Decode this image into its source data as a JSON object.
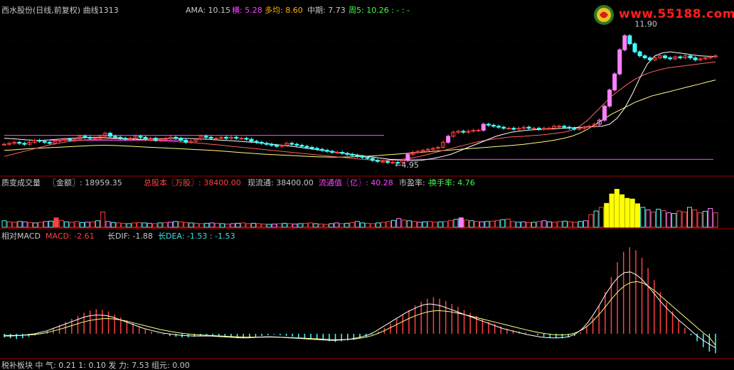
{
  "header": {
    "title": "西水股份(日线,前复权) 曲线1313",
    "ama_label": "AMA: 10.15",
    "heng_label": "横: 5.28",
    "duojun_label": "多均: 8.60",
    "zhongqi_label": "中期: 7.73",
    "zhou5_label": "周5: 10.26 : - : -"
  },
  "watermark": {
    "text": "www.55188.com",
    "icon": "logo-icon"
  },
  "volume_header": {
    "name": "质变成交量",
    "amount_label": "〖金额〗: 18959.35",
    "total_shares_label": "总股本〖万股〗: 38400.00",
    "float_label": "现流通: 38400.00",
    "float_value_label": "流通值〖亿〗: 40.28",
    "pe_label": "市盈率: -",
    "turnover_label": "换手率: 4.76"
  },
  "macd_header": {
    "name": "相对MACD",
    "macd_label": "MACD: -2.61",
    "dif_label": "长DIF: -1.88",
    "dea_label": "长DEA: -1.53 : -1.53"
  },
  "bottom_header": {
    "text": "税补板块 中 气: 0.21  1: 0.10  发 力: 7.53  组元: 0.00"
  },
  "chart_data": {
    "type": "candlestick",
    "price_annotations": {
      "high": "11.90",
      "low": "4.95"
    },
    "close": [
      5.9,
      5.95,
      6.0,
      5.95,
      5.9,
      6.0,
      6.1,
      6.05,
      6.0,
      5.95,
      6.05,
      6.1,
      6.15,
      6.1,
      6.15,
      6.3,
      6.25,
      6.2,
      6.2,
      6.3,
      6.45,
      6.3,
      6.25,
      6.2,
      6.15,
      6.2,
      6.3,
      6.25,
      6.15,
      6.2,
      6.1,
      6.15,
      6.2,
      6.25,
      6.2,
      6.1,
      6.0,
      6.05,
      6.15,
      6.3,
      6.25,
      6.2,
      6.2,
      6.25,
      6.2,
      6.25,
      6.2,
      6.2,
      6.15,
      6.05,
      6.0,
      5.95,
      5.9,
      5.85,
      5.8,
      5.85,
      5.95,
      5.9,
      5.85,
      5.8,
      5.75,
      5.7,
      5.65,
      5.6,
      5.55,
      5.5,
      5.5,
      5.45,
      5.4,
      5.35,
      5.3,
      5.25,
      5.2,
      5.1,
      5.05,
      5.05,
      5.0,
      5.0,
      4.98,
      5.1,
      5.4,
      5.5,
      5.55,
      5.6,
      5.65,
      5.7,
      5.75,
      6.0,
      6.3,
      6.5,
      6.55,
      6.5,
      6.55,
      6.6,
      6.6,
      6.9,
      6.85,
      6.8,
      6.75,
      6.7,
      6.7,
      6.65,
      6.7,
      6.75,
      6.7,
      6.7,
      6.65,
      6.7,
      6.7,
      6.8,
      6.8,
      6.75,
      6.7,
      6.65,
      6.7,
      6.75,
      6.8,
      6.9,
      7.1,
      7.8,
      8.6,
      9.4,
      10.6,
      11.3,
      10.9,
      10.5,
      10.3,
      10.2,
      10.1,
      10.2,
      10.3,
      10.2,
      10.15,
      10.25,
      10.2,
      10.3,
      10.2,
      10.1,
      10.15,
      10.2,
      10.25,
      10.3
    ],
    "ma_short": [
      6.2,
      6.18,
      6.15,
      6.12,
      6.1,
      6.1,
      6.12,
      6.15,
      6.18,
      6.2,
      6.22,
      6.24,
      6.25,
      6.24,
      6.22,
      6.2,
      6.18,
      6.16,
      6.15,
      6.15,
      6.16,
      6.18,
      6.19,
      6.2,
      6.19,
      6.18,
      6.16,
      6.15,
      6.12,
      6.1,
      6.08,
      6.05,
      6.02,
      6.0,
      5.96,
      5.92,
      5.88,
      5.84,
      5.8,
      5.75,
      5.7,
      5.65,
      5.6,
      5.55,
      5.5,
      5.45,
      5.4,
      5.35,
      5.3,
      5.25,
      5.2,
      5.15,
      5.12,
      5.1,
      5.08,
      5.1,
      5.15,
      5.22,
      5.3,
      5.4,
      5.55,
      5.7,
      5.85,
      6.0,
      6.15,
      6.3,
      6.4,
      6.5,
      6.55,
      6.6,
      6.62,
      6.64,
      6.66,
      6.68,
      6.7,
      6.72,
      6.74,
      6.76,
      6.78,
      6.8,
      6.9,
      7.2,
      7.7,
      8.4,
      9.2,
      9.9,
      10.3,
      10.45,
      10.5,
      10.45,
      10.4,
      10.35,
      10.3,
      10.28,
      10.26
    ],
    "ma_mid": [
      5.3,
      5.4,
      5.5,
      5.6,
      5.7,
      5.8,
      5.9,
      5.97,
      6.03,
      6.08,
      6.12,
      6.14,
      6.15,
      6.16,
      6.16,
      6.15,
      6.14,
      6.12,
      6.1,
      6.08,
      6.06,
      6.04,
      6.02,
      6.0,
      5.97,
      5.94,
      5.9,
      5.86,
      5.82,
      5.78,
      5.74,
      5.7,
      5.66,
      5.62,
      5.58,
      5.54,
      5.5,
      5.46,
      5.42,
      5.38,
      5.34,
      5.3,
      5.26,
      5.22,
      5.18,
      5.15,
      5.12,
      5.1,
      5.1,
      5.12,
      5.16,
      5.22,
      5.3,
      5.4,
      5.5,
      5.6,
      5.7,
      5.8,
      5.9,
      6.0,
      6.08,
      6.15,
      6.2,
      6.25,
      6.28,
      6.3,
      6.33,
      6.36,
      6.4,
      6.45,
      6.5,
      6.6,
      6.8,
      7.1,
      7.5,
      7.9,
      8.3,
      8.6,
      8.9,
      9.15,
      9.35,
      9.5,
      9.6,
      9.7,
      9.75,
      9.8,
      9.85,
      9.9,
      9.95,
      10.0
    ],
    "ma_long": [
      5.6,
      5.62,
      5.65,
      5.68,
      5.7,
      5.72,
      5.74,
      5.76,
      5.78,
      5.8,
      5.82,
      5.84,
      5.85,
      5.85,
      5.84,
      5.82,
      5.8,
      5.78,
      5.76,
      5.74,
      5.72,
      5.7,
      5.68,
      5.66,
      5.64,
      5.62,
      5.6,
      5.57,
      5.54,
      5.51,
      5.48,
      5.45,
      5.42,
      5.4,
      5.38,
      5.36,
      5.34,
      5.32,
      5.3,
      5.28,
      5.27,
      5.26,
      5.26,
      5.27,
      5.28,
      5.3,
      5.32,
      5.35,
      5.38,
      5.41,
      5.44,
      5.47,
      5.5,
      5.53,
      5.56,
      5.59,
      5.62,
      5.65,
      5.68,
      5.71,
      5.74,
      5.77,
      5.8,
      5.83,
      5.86,
      5.9,
      5.95,
      6.0,
      6.05,
      6.12,
      6.2,
      6.3,
      6.45,
      6.65,
      6.9,
      7.15,
      7.4,
      7.6,
      7.8,
      8.0,
      8.15,
      8.3,
      8.4,
      8.5,
      8.6,
      8.7,
      8.8,
      8.9,
      9.0,
      9.1
    ],
    "volume": [
      1.8,
      1.5,
      1.4,
      1.6,
      1.5,
      1.3,
      1.2,
      1.4,
      1.6,
      1.7,
      2.6,
      1.9,
      1.5,
      1.4,
      1.6,
      1.3,
      1.4,
      1.5,
      1.8,
      4.2,
      1.6,
      1.3,
      1.2,
      1.1,
      1.0,
      1.2,
      1.3,
      1.2,
      1.1,
      1.0,
      1.2,
      1.3,
      1.4,
      1.6,
      1.5,
      1.3,
      1.2,
      1.1,
      1.0,
      1.1,
      1.2,
      1.1,
      1.0,
      0.9,
      1.0,
      1.1,
      1.2,
      1.0,
      1.1,
      1.0,
      0.9,
      0.8,
      0.9,
      1.0,
      1.1,
      1.0,
      0.9,
      1.0,
      1.1,
      1.2,
      1.0,
      0.9,
      0.8,
      1.0,
      1.2,
      1.0,
      1.1,
      1.3,
      1.6,
      1.2,
      1.1,
      1.0,
      1.2,
      1.4,
      1.6,
      1.9,
      2.4,
      2.0,
      1.8,
      1.6,
      1.4,
      1.5,
      1.6,
      1.4,
      1.5,
      1.6,
      1.9,
      2.2,
      2.6,
      2.0,
      1.8,
      1.6,
      1.5,
      1.6,
      1.7,
      1.9,
      2.1,
      2.3,
      1.6,
      1.4,
      1.5,
      1.3,
      1.4,
      1.6,
      1.8,
      1.5,
      1.4,
      1.6,
      1.7,
      1.5,
      1.4,
      1.6,
      1.8,
      3.5,
      4.5,
      5.5,
      6.6,
      9.2,
      10.5,
      9.0,
      8.0,
      7.8,
      6.5,
      5.5,
      4.8,
      4.2,
      5.0,
      4.6,
      4.0,
      3.8,
      4.5,
      4.2,
      5.5,
      4.8,
      4.0,
      4.4,
      5.2,
      4.0
    ],
    "macd_hist": [
      -0.5,
      -0.6,
      -0.7,
      -0.6,
      -0.4,
      -0.2,
      0.1,
      0.4,
      0.8,
      1.2,
      1.6,
      2.0,
      2.4,
      2.8,
      3.1,
      3.3,
      3.2,
      3.0,
      2.6,
      2.2,
      1.8,
      1.4,
      1.0,
      0.6,
      0.3,
      0.1,
      -0.1,
      -0.3,
      -0.4,
      -0.5,
      -0.5,
      -0.4,
      -0.3,
      -0.2,
      -0.2,
      -0.3,
      -0.4,
      -0.5,
      -0.6,
      -0.6,
      -0.5,
      -0.4,
      -0.3,
      -0.2,
      -0.1,
      -0.2,
      -0.3,
      -0.4,
      -0.5,
      -0.6,
      -0.7,
      -0.8,
      -0.9,
      -1.0,
      -1.1,
      -1.0,
      -0.9,
      -0.8,
      -0.6,
      -0.4,
      -0.1,
      0.3,
      0.8,
      1.4,
      2.0,
      2.6,
      3.2,
      3.8,
      4.3,
      4.7,
      4.9,
      4.7,
      4.4,
      4.0,
      3.6,
      3.2,
      2.8,
      2.4,
      2.0,
      1.6,
      1.3,
      1.0,
      0.7,
      0.5,
      0.3,
      0.2,
      0.0,
      -0.2,
      -0.4,
      -0.5,
      -0.6,
      -0.6,
      -0.5,
      -0.3,
      0.2,
      1.0,
      2.2,
      3.8,
      5.6,
      7.6,
      9.6,
      11.0,
      11.6,
      11.2,
      10.2,
      8.8,
      7.2,
      5.6,
      4.2,
      3.0,
      1.8,
      0.8,
      -0.2,
      -1.0,
      -1.8,
      -2.4,
      -2.6
    ],
    "dif": [
      -0.3,
      -0.3,
      -0.25,
      -0.2,
      -0.1,
      0.0,
      0.2,
      0.4,
      0.7,
      1.0,
      1.3,
      1.6,
      1.9,
      2.2,
      2.4,
      2.5,
      2.5,
      2.4,
      2.2,
      1.9,
      1.6,
      1.3,
      1.0,
      0.7,
      0.5,
      0.3,
      0.1,
      0.0,
      -0.1,
      -0.2,
      -0.25,
      -0.3,
      -0.3,
      -0.3,
      -0.3,
      -0.35,
      -0.4,
      -0.45,
      -0.5,
      -0.55,
      -0.55,
      -0.5,
      -0.45,
      -0.4,
      -0.4,
      -0.45,
      -0.5,
      -0.55,
      -0.6,
      -0.65,
      -0.7,
      -0.75,
      -0.8,
      -0.85,
      -0.9,
      -0.85,
      -0.8,
      -0.7,
      -0.55,
      -0.35,
      -0.1,
      0.3,
      0.8,
      1.3,
      1.8,
      2.3,
      2.8,
      3.2,
      3.6,
      3.9,
      4.0,
      3.9,
      3.7,
      3.4,
      3.1,
      2.8,
      2.5,
      2.2,
      1.9,
      1.6,
      1.3,
      1.0,
      0.7,
      0.5,
      0.3,
      0.1,
      -0.1,
      -0.25,
      -0.4,
      -0.5,
      -0.55,
      -0.55,
      -0.5,
      -0.35,
      0.0,
      0.6,
      1.5,
      2.7,
      4.0,
      5.4,
      6.6,
      7.6,
      8.2,
      8.3,
      7.9,
      7.2,
      6.3,
      5.3,
      4.3,
      3.4,
      2.6,
      1.8,
      1.1,
      0.4,
      -0.3,
      -0.9,
      -1.4,
      -1.88
    ],
    "dea": [
      -0.2,
      -0.22,
      -0.22,
      -0.2,
      -0.15,
      -0.1,
      0.0,
      0.15,
      0.35,
      0.55,
      0.8,
      1.05,
      1.3,
      1.55,
      1.75,
      1.9,
      2.0,
      2.05,
      2.0,
      1.9,
      1.75,
      1.55,
      1.35,
      1.15,
      0.95,
      0.75,
      0.55,
      0.4,
      0.25,
      0.12,
      0.02,
      -0.07,
      -0.13,
      -0.18,
      -0.22,
      -0.26,
      -0.3,
      -0.34,
      -0.38,
      -0.42,
      -0.45,
      -0.46,
      -0.46,
      -0.45,
      -0.44,
      -0.45,
      -0.47,
      -0.5,
      -0.53,
      -0.56,
      -0.6,
      -0.64,
      -0.68,
      -0.72,
      -0.76,
      -0.78,
      -0.78,
      -0.75,
      -0.7,
      -0.6,
      -0.45,
      -0.25,
      0.05,
      0.4,
      0.8,
      1.2,
      1.6,
      2.0,
      2.35,
      2.65,
      2.9,
      3.05,
      3.1,
      3.05,
      2.95,
      2.8,
      2.65,
      2.45,
      2.25,
      2.05,
      1.85,
      1.65,
      1.45,
      1.25,
      1.05,
      0.85,
      0.65,
      0.45,
      0.28,
      0.12,
      0.0,
      -0.1,
      -0.15,
      -0.15,
      -0.05,
      0.2,
      0.6,
      1.2,
      2.0,
      2.9,
      3.9,
      4.9,
      5.8,
      6.5,
      6.9,
      7.0,
      6.8,
      6.3,
      5.7,
      5.0,
      4.3,
      3.6,
      2.9,
      2.2,
      1.5,
      0.8,
      0.1,
      -0.5,
      -1.53
    ]
  },
  "colors": {
    "up": "#ff4040",
    "down": "#40ffff",
    "up_strong": "#ff80ff",
    "volume_surge": "#ffff00",
    "ma_short": "#ffffff",
    "ma_mid": "#ff6060",
    "ma_long": "#ffff80",
    "baseline": "#ff40ff",
    "grid": "#800000"
  }
}
